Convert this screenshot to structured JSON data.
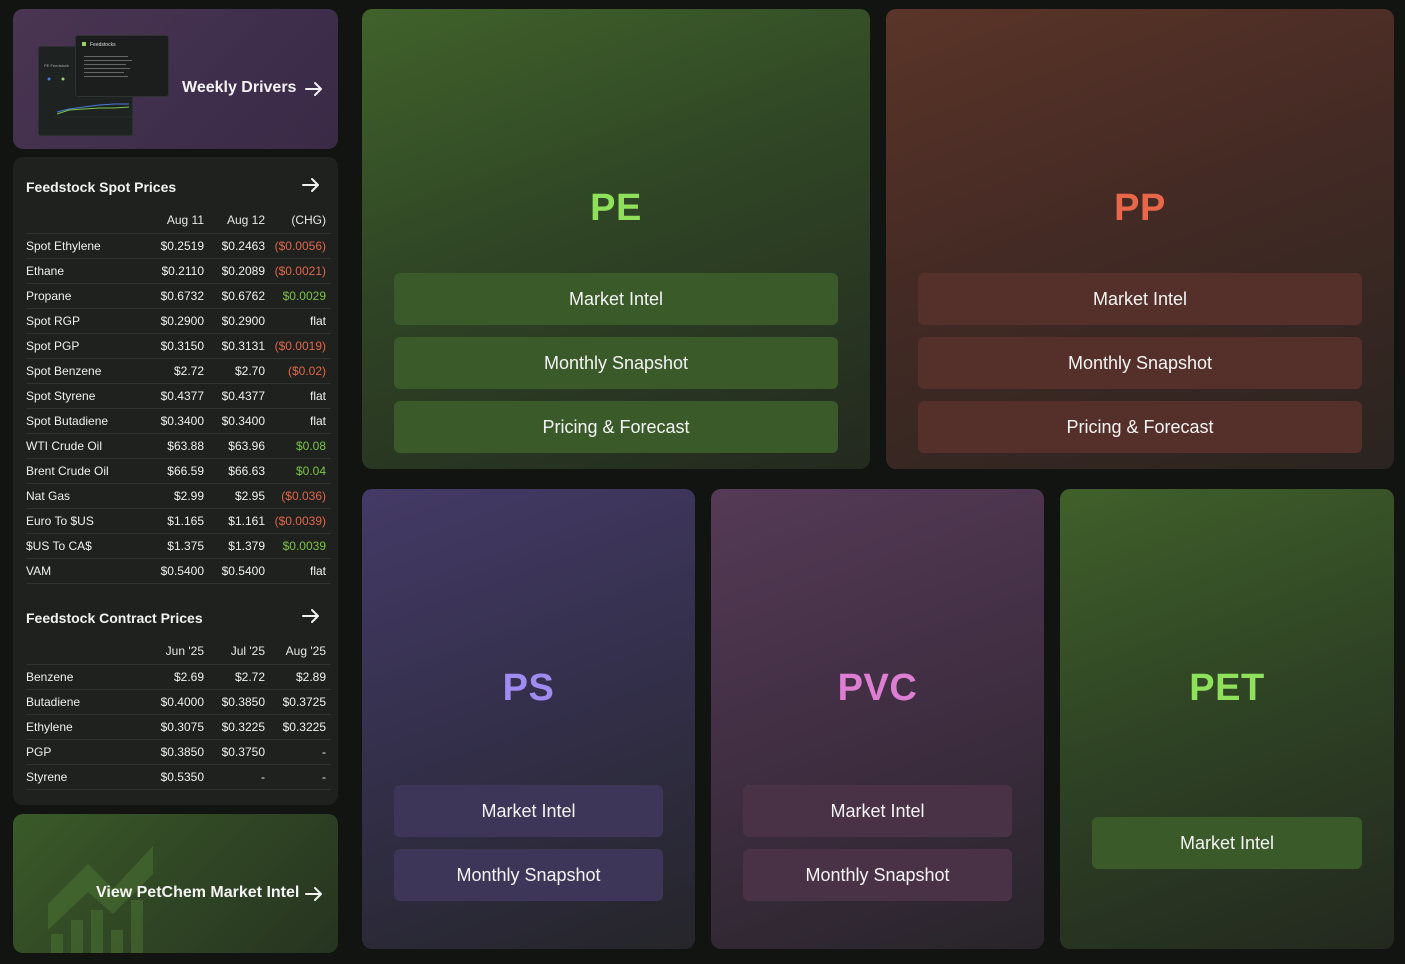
{
  "weekly_drivers": {
    "label": "Weekly Drivers",
    "thumbnail": {
      "heading": "Feedstocks",
      "sub": "PE Feedstock"
    }
  },
  "spot_prices": {
    "title": "Feedstock Spot Prices",
    "columns": [
      "Aug 11",
      "Aug 12",
      "(CHG)"
    ],
    "rows": [
      {
        "name": "Spot Ethylene",
        "c1": "$0.2519",
        "c2": "$0.2463",
        "chg": "($0.0056)",
        "dir": "neg"
      },
      {
        "name": "Ethane",
        "c1": "$0.2110",
        "c2": "$0.2089",
        "chg": "($0.0021)",
        "dir": "neg"
      },
      {
        "name": "Propane",
        "c1": "$0.6732",
        "c2": "$0.6762",
        "chg": "$0.0029",
        "dir": "pos"
      },
      {
        "name": "Spot RGP",
        "c1": "$0.2900",
        "c2": "$0.2900",
        "chg": "flat",
        "dir": "flat"
      },
      {
        "name": "Spot PGP",
        "c1": "$0.3150",
        "c2": "$0.3131",
        "chg": "($0.0019)",
        "dir": "neg"
      },
      {
        "name": "Spot Benzene",
        "c1": "$2.72",
        "c2": "$2.70",
        "chg": "($0.02)",
        "dir": "neg"
      },
      {
        "name": "Spot Styrene",
        "c1": "$0.4377",
        "c2": "$0.4377",
        "chg": "flat",
        "dir": "flat"
      },
      {
        "name": "Spot Butadiene",
        "c1": "$0.3400",
        "c2": "$0.3400",
        "chg": "flat",
        "dir": "flat"
      },
      {
        "name": "WTI Crude Oil",
        "c1": "$63.88",
        "c2": "$63.96",
        "chg": "$0.08",
        "dir": "pos"
      },
      {
        "name": "Brent Crude Oil",
        "c1": "$66.59",
        "c2": "$66.63",
        "chg": "$0.04",
        "dir": "pos"
      },
      {
        "name": "Nat Gas",
        "c1": "$2.99",
        "c2": "$2.95",
        "chg": "($0.036)",
        "dir": "neg"
      },
      {
        "name": "Euro To $US",
        "c1": "$1.165",
        "c2": "$1.161",
        "chg": "($0.0039)",
        "dir": "neg"
      },
      {
        "name": "$US To CA$",
        "c1": "$1.375",
        "c2": "$1.379",
        "chg": "$0.0039",
        "dir": "pos"
      },
      {
        "name": "VAM",
        "c1": "$0.5400",
        "c2": "$0.5400",
        "chg": "flat",
        "dir": "flat"
      }
    ]
  },
  "contract_prices": {
    "title": "Feedstock Contract Prices",
    "columns": [
      "Jun '25",
      "Jul '25",
      "Aug '25"
    ],
    "rows": [
      {
        "name": "Benzene",
        "c1": "$2.69",
        "c2": "$2.72",
        "c3": "$2.89"
      },
      {
        "name": "Butadiene",
        "c1": "$0.4000",
        "c2": "$0.3850",
        "c3": "$0.3725"
      },
      {
        "name": "Ethylene",
        "c1": "$0.3075",
        "c2": "$0.3225",
        "c3": "$0.3225"
      },
      {
        "name": "PGP",
        "c1": "$0.3850",
        "c2": "$0.3750",
        "c3": "-"
      },
      {
        "name": "Styrene",
        "c1": "$0.5350",
        "c2": "-",
        "c3": "-"
      }
    ]
  },
  "petchem": {
    "label": "View PetChem Market Intel"
  },
  "products": {
    "pe": {
      "title": "PE",
      "buttons": [
        "Market Intel",
        "Monthly Snapshot",
        "Pricing & Forecast"
      ]
    },
    "pp": {
      "title": "PP",
      "buttons": [
        "Market Intel",
        "Monthly Snapshot",
        "Pricing & Forecast"
      ]
    },
    "ps": {
      "title": "PS",
      "buttons": [
        "Market Intel",
        "Monthly Snapshot"
      ]
    },
    "pvc": {
      "title": "PVC",
      "buttons": [
        "Market Intel",
        "Monthly Snapshot"
      ]
    },
    "pet": {
      "title": "PET",
      "buttons": [
        "Market Intel"
      ]
    }
  },
  "colors": {
    "background": "#111410",
    "negative": "#e0664a",
    "positive": "#7cc443",
    "pe_accent": "#8fe05a",
    "pp_accent": "#e8674a",
    "ps_accent": "#a08cf0",
    "pvc_accent": "#dd7ed3",
    "pet_accent": "#8fe05a"
  }
}
